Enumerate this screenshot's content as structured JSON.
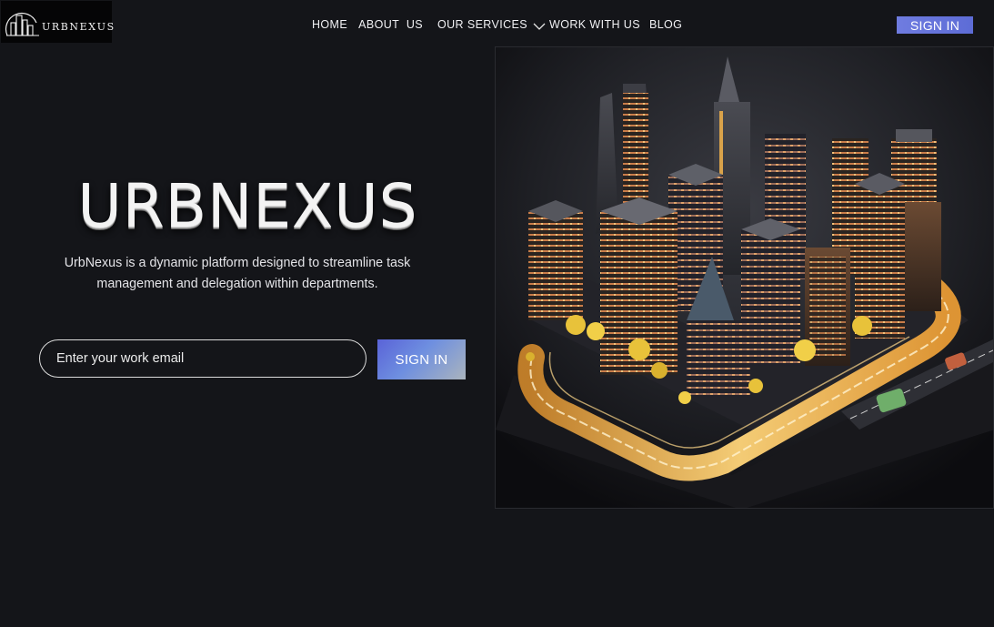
{
  "brand": {
    "name": "URBNEXUS"
  },
  "nav": {
    "items": [
      {
        "label": "HOME"
      },
      {
        "label": "ABOUT US"
      },
      {
        "label": "OUR SERVICES"
      },
      {
        "label": "WORK WITH US"
      },
      {
        "label": "BLOG"
      }
    ]
  },
  "header": {
    "signin_label": "SIGN IN"
  },
  "hero": {
    "title": "URBNEXUS",
    "description": "UrbNexus is a dynamic platform designed to streamline task management and delegation within departments.",
    "email_placeholder": "Enter your work email",
    "email_value": "",
    "signin_label": "SIGN IN"
  },
  "colors": {
    "background": "#141519",
    "accent_start": "#5a63d8",
    "accent_end": "#aab4bd",
    "highlight": "#f6b740"
  },
  "icons": {
    "services_dropdown": "chevron-down-icon",
    "logo": "city-skyline-icon"
  }
}
